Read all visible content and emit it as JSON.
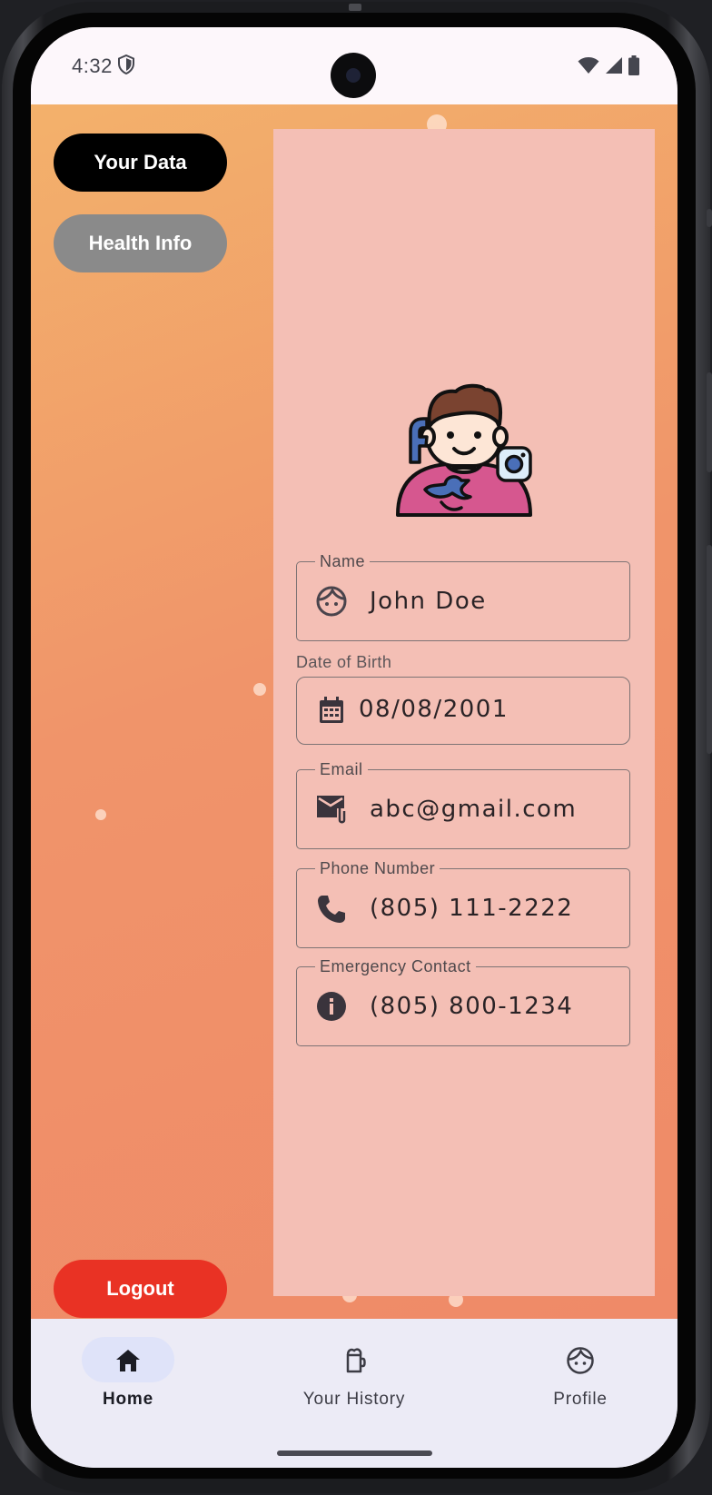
{
  "status_bar": {
    "time": "4:32",
    "icons": [
      "shield-icon",
      "wifi-icon",
      "cellular-icon",
      "battery-icon"
    ]
  },
  "sidebar": {
    "your_data_label": "Your Data",
    "health_info_label": "Health Info",
    "logout_label": "Logout"
  },
  "profile": {
    "avatar_icon": "user-social-avatar-icon",
    "fields": {
      "name": {
        "label": "Name",
        "value": "John Doe",
        "icon": "face-icon"
      },
      "dob": {
        "label": "Date of Birth",
        "value": "08/08/2001",
        "icon": "calendar-icon"
      },
      "email": {
        "label": "Email",
        "value": "abc@gmail.com",
        "icon": "mail-attachment-icon"
      },
      "phone": {
        "label": "Phone Number",
        "value": "(805) 111-2222",
        "icon": "phone-icon"
      },
      "emergency": {
        "label": "Emergency Contact",
        "value": "(805) 800-1234",
        "icon": "info-icon"
      }
    }
  },
  "bottom_nav": {
    "items": [
      {
        "label": "Home",
        "icon": "home-icon",
        "active": true
      },
      {
        "label": "Your History",
        "icon": "history-icon",
        "active": false
      },
      {
        "label": "Profile",
        "icon": "face-icon",
        "active": false
      }
    ]
  },
  "colors": {
    "primary_button": "#000000",
    "secondary_button": "#8a8a8a",
    "logout_button": "#e93224",
    "panel_background": "#f4bfb5",
    "nav_background": "#ecebf6",
    "nav_active_indicator": "#dfe3f9"
  }
}
